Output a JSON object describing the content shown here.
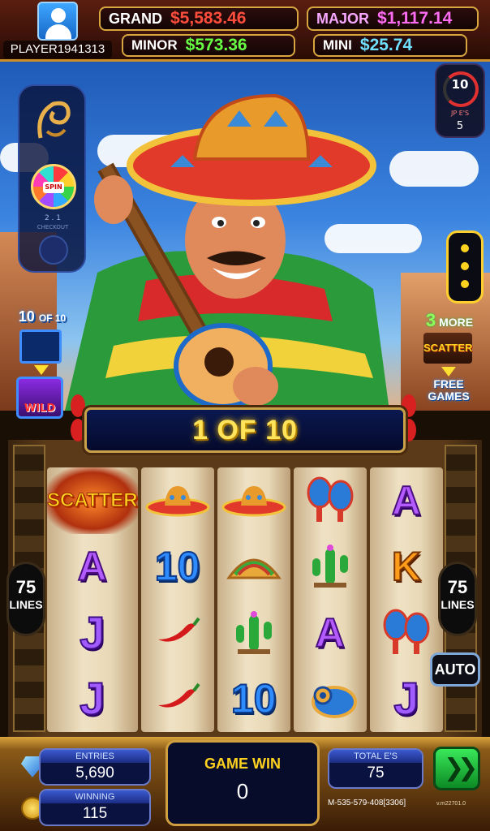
{
  "player": {
    "name": "PLAYER1941313",
    "avatar_icon": "user-avatar-icon"
  },
  "jackpots": {
    "grand": {
      "label": "GRAND",
      "value": "$5,583.46",
      "color": "#ff4d3d"
    },
    "major": {
      "label": "MAJOR",
      "value": "$1,117.14",
      "color": "#ff6cf4"
    },
    "minor": {
      "label": "MINOR",
      "value": "$573.36",
      "color": "#66ff44"
    },
    "mini": {
      "label": "MINI",
      "value": "$25.74",
      "color": "#6fe0ff"
    }
  },
  "jp_counter": {
    "value": "10",
    "label": "JP E'S",
    "sub": "5"
  },
  "side_panel": {
    "spin_label": "SPIN",
    "stat": "2 . 1",
    "sub": "CHECKOUT"
  },
  "wild_feature": {
    "count": "10",
    "of": "OF 10",
    "label": "WILD"
  },
  "free_feature": {
    "count": "3",
    "more": "MORE",
    "scatter": "SCATTER",
    "free_games_1": "FREE",
    "free_games_2": "GAMES"
  },
  "free_spin_counter": "1 OF 10",
  "lines": {
    "count": "75",
    "label": "LINES"
  },
  "reels": [
    [
      "SCATTER",
      "A",
      "J",
      "J"
    ],
    [
      "sombrero",
      "10",
      "chili-pepper",
      "chili-pepper"
    ],
    [
      "sombrero",
      "taco",
      "cactus",
      "10"
    ],
    [
      "maracas",
      "cactus",
      "A",
      "donut-drum"
    ],
    [
      "A",
      "K",
      "maracas",
      "J"
    ]
  ],
  "buttons": {
    "auto": "AUTO",
    "spin_icon": "double-chevron-right-icon"
  },
  "bottom": {
    "entries": {
      "label": "ENTRIES",
      "value": "5,690"
    },
    "winning": {
      "label": "WINNING",
      "value": "115"
    },
    "game_win": {
      "label": "GAME WIN",
      "value": "0"
    },
    "total_es": {
      "label": "TOTAL E'S",
      "value": "75"
    },
    "machine_id": "M-535-579-408[3306]",
    "version": "v.m22701.0"
  }
}
